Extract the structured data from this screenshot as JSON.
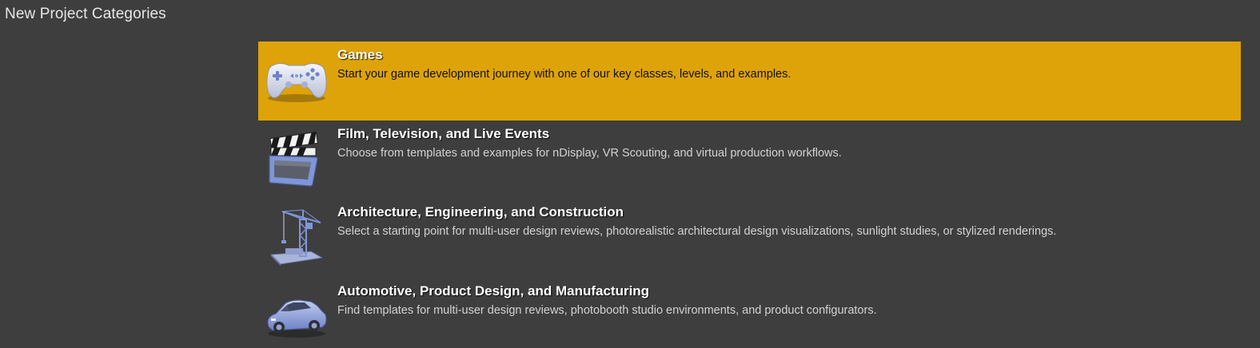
{
  "header": {
    "title": "New Project Categories"
  },
  "colors": {
    "background": "#3e3e3e",
    "selected": "#dea309",
    "icon_blue": "#7f96d6"
  },
  "categories": [
    {
      "title": "Games",
      "description": "Start your game development journey with one of our key classes, levels, and examples.",
      "icon": "gamepad-icon",
      "selected": true
    },
    {
      "title": "Film, Television, and Live Events",
      "description": "Choose from templates and examples for nDisplay, VR Scouting, and virtual production workflows.",
      "icon": "clapperboard-icon",
      "selected": false
    },
    {
      "title": "Architecture, Engineering, and Construction",
      "description": "Select a starting point for multi-user design reviews, photorealistic architectural design visualizations, sunlight studies, or stylized renderings.",
      "icon": "crane-icon",
      "selected": false
    },
    {
      "title": "Automotive, Product Design, and Manufacturing",
      "description": "Find templates for multi-user design reviews, photobooth studio environments, and product configurators.",
      "icon": "car-icon",
      "selected": false
    }
  ]
}
